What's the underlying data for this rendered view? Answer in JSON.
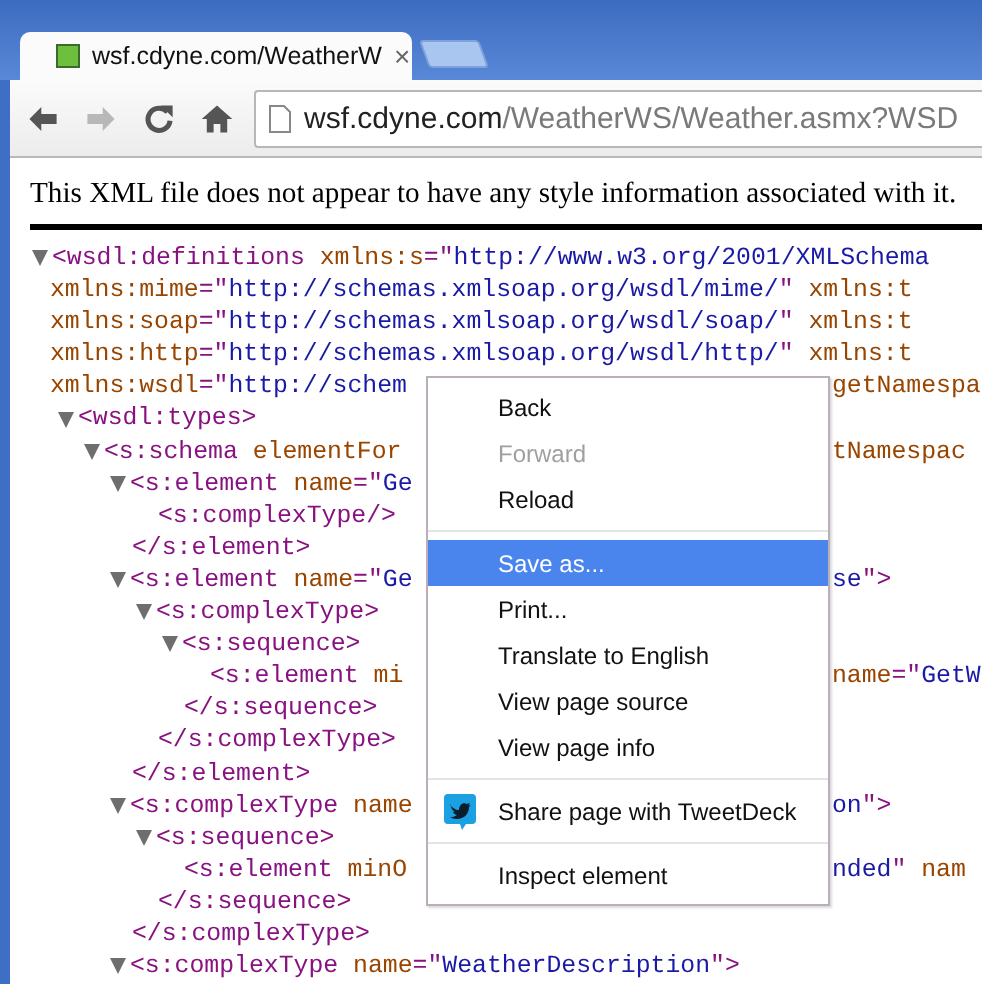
{
  "tab": {
    "title": "wsf.cdyne.com/WeatherW",
    "close": "×",
    "selected": true
  },
  "toolbar": {
    "buttons": [
      {
        "kind": "back",
        "disabled": false
      },
      {
        "kind": "forward",
        "disabled": true
      },
      {
        "kind": "reload",
        "disabled": false
      },
      {
        "kind": "home",
        "disabled": false
      }
    ],
    "address": {
      "host": "wsf.cdyne.com",
      "path": "/WeatherWS/Weather.asmx?WSD"
    }
  },
  "notice": "This XML file does not appear to have any style information associated with it.",
  "code": [
    {
      "expanded": true,
      "lines": [
        {
          "parts": [
            {
              "kind": "tag",
              "text": "<wsdl:definitions "
            },
            {
              "kind": "attr",
              "text": "xmlns:s"
            },
            {
              "kind": "tag",
              "text": "=\""
            },
            {
              "kind": "value",
              "text": "http://www.w3.org/2001/XMLSchema"
            }
          ]
        },
        {
          "parts": [
            {
              "kind": "attr",
              "text": "xmlns:mime"
            },
            {
              "kind": "tag",
              "text": "=\""
            },
            {
              "kind": "value",
              "text": "http://schemas.xmlsoap.org/wsdl/mime/"
            },
            {
              "kind": "tag",
              "text": "\" "
            },
            {
              "kind": "attr",
              "text": "xmlns:t"
            }
          ]
        },
        {
          "parts": [
            {
              "kind": "attr",
              "text": "xmlns:soap"
            },
            {
              "kind": "tag",
              "text": "=\""
            },
            {
              "kind": "value",
              "text": "http://schemas.xmlsoap.org/wsdl/soap/"
            },
            {
              "kind": "tag",
              "text": "\" "
            },
            {
              "kind": "attr",
              "text": "xmlns:t"
            }
          ]
        },
        {
          "parts": [
            {
              "kind": "attr",
              "text": "xmlns:http"
            },
            {
              "kind": "tag",
              "text": "=\""
            },
            {
              "kind": "value",
              "text": "http://schemas.xmlsoap.org/wsdl/http/"
            },
            {
              "kind": "tag",
              "text": "\" "
            },
            {
              "kind": "attr",
              "text": "xmlns:t"
            }
          ]
        },
        {
          "parts": [
            {
              "kind": "attr",
              "text": "xmlns:wsdl"
            },
            {
              "kind": "tag",
              "text": "=\""
            },
            {
              "kind": "value",
              "text": "http://schem"
            }
          ],
          "tail": [
            {
              "kind": "attr",
              "text": "getNamespa"
            }
          ]
        }
      ],
      "children": [
        {
          "expanded": true,
          "lines": [
            {
              "parts": [
                {
                  "kind": "tag",
                  "text": "<wsdl:types>"
                }
              ]
            }
          ],
          "children": [
            {
              "expanded": true,
              "lines": [
                {
                  "parts": [
                    {
                      "kind": "tag",
                      "text": "<s:schema "
                    },
                    {
                      "kind": "attr",
                      "text": "elementFor"
                    }
                  ],
                  "tail": [
                    {
                      "kind": "attr",
                      "text": "tNamespac"
                    }
                  ]
                }
              ],
              "children": [
                {
                  "expanded": true,
                  "lines": [
                    {
                      "parts": [
                        {
                          "kind": "tag",
                          "text": "<s:element "
                        },
                        {
                          "kind": "attr",
                          "text": "name"
                        },
                        {
                          "kind": "tag",
                          "text": "=\""
                        },
                        {
                          "kind": "value",
                          "text": "Ge"
                        }
                      ]
                    }
                  ],
                  "children": [
                    {
                      "lines": [
                        {
                          "parts": [
                            {
                              "kind": "tag",
                              "text": "<s:complexType/>"
                            }
                          ]
                        }
                      ]
                    }
                  ],
                  "close": [
                    {
                      "kind": "tag",
                      "text": "</s:element>"
                    }
                  ]
                },
                {
                  "expanded": true,
                  "lines": [
                    {
                      "parts": [
                        {
                          "kind": "tag",
                          "text": "<s:element "
                        },
                        {
                          "kind": "attr",
                          "text": "name"
                        },
                        {
                          "kind": "tag",
                          "text": "=\""
                        },
                        {
                          "kind": "value",
                          "text": "Ge"
                        }
                      ],
                      "tail": [
                        {
                          "kind": "value",
                          "text": "se"
                        },
                        {
                          "kind": "tag",
                          "text": "\">"
                        }
                      ]
                    }
                  ],
                  "children": [
                    {
                      "expanded": true,
                      "lines": [
                        {
                          "parts": [
                            {
                              "kind": "tag",
                              "text": "<s:complexType>"
                            }
                          ]
                        }
                      ],
                      "children": [
                        {
                          "expanded": true,
                          "lines": [
                            {
                              "parts": [
                                {
                                  "kind": "tag",
                                  "text": "<s:sequence>"
                                }
                              ]
                            }
                          ],
                          "children": [
                            {
                              "lines": [
                                {
                                  "parts": [
                                    {
                                      "kind": "tag",
                                      "text": "<s:element "
                                    },
                                    {
                                      "kind": "attr",
                                      "text": "mi"
                                    }
                                  ],
                                  "tail": [
                                    {
                                      "kind": "attr",
                                      "text": "name"
                                    },
                                    {
                                      "kind": "tag",
                                      "text": "=\""
                                    },
                                    {
                                      "kind": "value",
                                      "text": "GetW"
                                    }
                                  ]
                                }
                              ]
                            }
                          ],
                          "close": [
                            {
                              "kind": "tag",
                              "text": "</s:sequence>"
                            }
                          ]
                        }
                      ],
                      "close": [
                        {
                          "kind": "tag",
                          "text": "</s:complexType>"
                        }
                      ]
                    }
                  ],
                  "close": [
                    {
                      "kind": "tag",
                      "text": "</s:element>"
                    }
                  ]
                },
                {
                  "expanded": true,
                  "lines": [
                    {
                      "parts": [
                        {
                          "kind": "tag",
                          "text": "<s:complexType "
                        },
                        {
                          "kind": "attr",
                          "text": "name"
                        }
                      ],
                      "tail": [
                        {
                          "kind": "value",
                          "text": "on"
                        },
                        {
                          "kind": "tag",
                          "text": "\">"
                        }
                      ]
                    }
                  ],
                  "children": [
                    {
                      "expanded": true,
                      "lines": [
                        {
                          "parts": [
                            {
                              "kind": "tag",
                              "text": "<s:sequence>"
                            }
                          ]
                        }
                      ],
                      "children": [
                        {
                          "lines": [
                            {
                              "parts": [
                                {
                                  "kind": "tag",
                                  "text": "<s:element "
                                },
                                {
                                  "kind": "attr",
                                  "text": "minO"
                                }
                              ],
                              "tail": [
                                {
                                  "kind": "value",
                                  "text": "nded"
                                },
                                {
                                  "kind": "tag",
                                  "text": "\" "
                                },
                                {
                                  "kind": "attr",
                                  "text": "nam"
                                }
                              ]
                            }
                          ]
                        }
                      ],
                      "close": [
                        {
                          "kind": "tag",
                          "text": "</s:sequence>"
                        }
                      ]
                    }
                  ],
                  "close": [
                    {
                      "kind": "tag",
                      "text": "</s:complexType>"
                    }
                  ]
                },
                {
                  "expanded": true,
                  "lines": [
                    {
                      "parts": [
                        {
                          "kind": "tag",
                          "text": "<s:complexType "
                        },
                        {
                          "kind": "attr",
                          "text": "name"
                        },
                        {
                          "kind": "tag",
                          "text": "=\""
                        },
                        {
                          "kind": "value",
                          "text": "WeatherDescription"
                        },
                        {
                          "kind": "tag",
                          "text": "\">"
                        }
                      ]
                    }
                  ]
                }
              ]
            }
          ]
        }
      ]
    }
  ],
  "menu": {
    "groups": [
      [
        {
          "label": "Back",
          "disabled": false,
          "selected": false
        },
        {
          "label": "Forward",
          "disabled": true,
          "selected": false
        },
        {
          "label": "Reload",
          "disabled": false,
          "selected": false
        }
      ],
      [
        {
          "label": "Save as...",
          "disabled": false,
          "selected": true
        },
        {
          "label": "Print...",
          "disabled": false,
          "selected": false
        },
        {
          "label": "Translate to English",
          "disabled": false,
          "selected": false
        },
        {
          "label": "View page source",
          "disabled": false,
          "selected": false
        },
        {
          "label": "View page info",
          "disabled": false,
          "selected": false
        }
      ],
      [
        {
          "label": "Share page with TweetDeck",
          "disabled": false,
          "selected": false,
          "kind": "bird"
        }
      ],
      [
        {
          "label": "Inspect element",
          "disabled": false,
          "selected": false
        }
      ]
    ]
  }
}
